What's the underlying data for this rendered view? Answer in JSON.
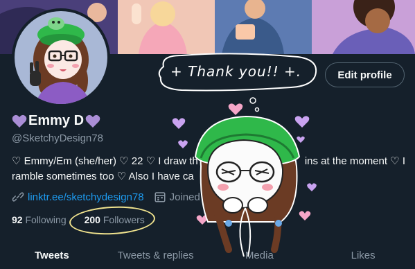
{
  "profile": {
    "display_name": "Emmy D",
    "handle": "@SketchyDesign78",
    "bio_line1": "♡ Emmy/Em (she/her) ♡ 22 ♡ I draw th",
    "bio_line1_right": "ins at the moment ♡ I",
    "bio_line2": "ramble sometimes too ♡ Also I have ca",
    "link": "linktr.ee/sketchydesign78",
    "joined": "Joined A",
    "following_count": "92",
    "following_label": "Following",
    "followers_count": "200",
    "followers_label": "Followers"
  },
  "actions": {
    "edit_profile_label": "Edit profile"
  },
  "tabs": [
    {
      "label": "Tweets",
      "active": true
    },
    {
      "label": "Tweets & replies",
      "active": false
    },
    {
      "label": "Media",
      "active": false
    },
    {
      "label": "Likes",
      "active": false
    }
  ],
  "overlay": {
    "speech_text": "+ Thank you!! +."
  },
  "colors": {
    "background": "#15202b",
    "accent_link": "#1d9bf0",
    "muted_text": "#8b98a5",
    "heart_purple": "#c9a3f0",
    "heart_pink": "#f5a6c8",
    "highlight_yellow": "#f0e38e",
    "hat_green": "#2fb84a"
  },
  "icons": {
    "link": "link-icon",
    "calendar": "calendar-icon",
    "heart": "purple-heart-icon"
  }
}
